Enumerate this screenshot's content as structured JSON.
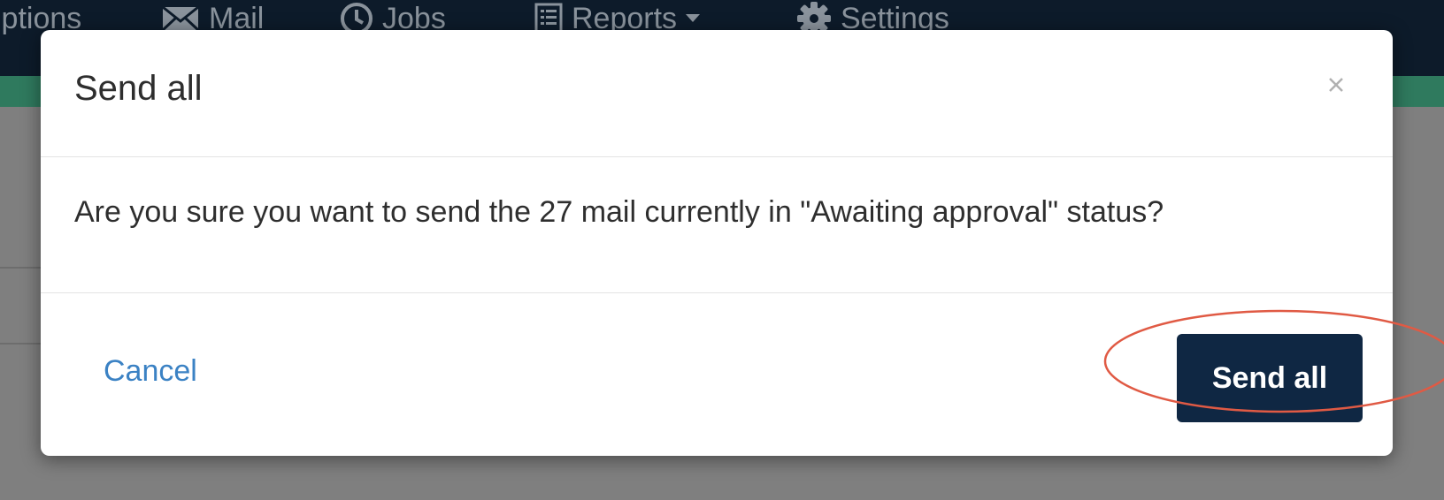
{
  "navbar": {
    "items": [
      {
        "label": "iptions",
        "icon": ""
      },
      {
        "label": "Mail",
        "icon": "mail-icon"
      },
      {
        "label": "Jobs",
        "icon": "clock-icon"
      },
      {
        "label": "Reports",
        "icon": "reports-icon",
        "has_dropdown": true
      },
      {
        "label": "Settings",
        "icon": "gear-icon"
      }
    ]
  },
  "modal": {
    "title": "Send all",
    "close_label": "×",
    "message": "Are you sure you want to send the 27 mail currently in \"Awaiting approval\" status?",
    "cancel_label": "Cancel",
    "confirm_label": "Send all"
  },
  "colors": {
    "navbar_bg": "#0d1b2a",
    "accent_bar": "#2f7a5e",
    "primary_button": "#0f2743",
    "link": "#3b82c4",
    "highlight_ring": "#e05a44"
  }
}
